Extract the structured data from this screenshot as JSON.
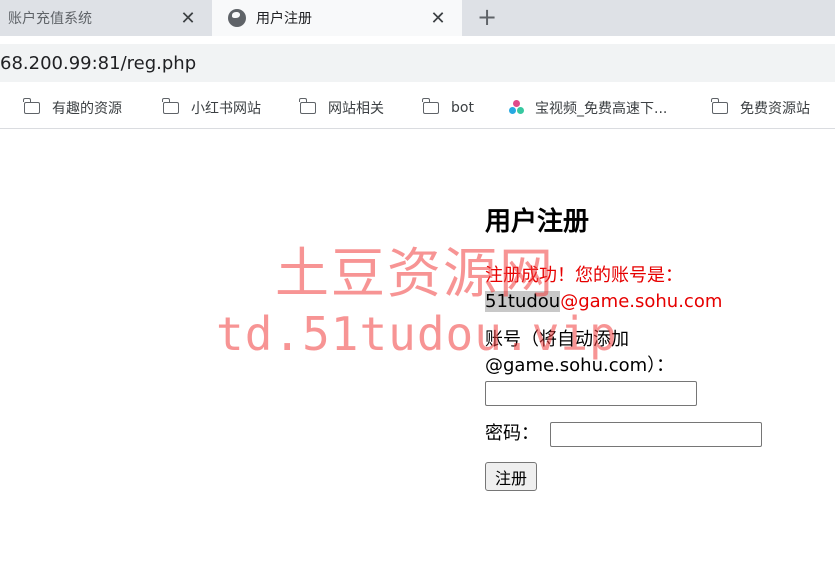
{
  "browser": {
    "tabs": [
      {
        "title": "账户充值系统",
        "active": false
      },
      {
        "title": "用户注册",
        "active": true
      }
    ],
    "close_glyph": "✕",
    "new_tab_glyph": "+",
    "url": "68.200.99:81/reg.php",
    "bookmarks": [
      {
        "label": "有趣的资源",
        "icon": "folder-icon"
      },
      {
        "label": "小红书网站",
        "icon": "folder-icon"
      },
      {
        "label": "网站相关",
        "icon": "folder-icon"
      },
      {
        "label": "bot",
        "icon": "folder-icon"
      },
      {
        "label": "宝视频_免费高速下...",
        "icon": "bilibili-icon"
      },
      {
        "label": "免费资源站",
        "icon": "folder-icon"
      }
    ]
  },
  "page": {
    "title": "用户注册",
    "success_prefix": "注册成功！您的账号是：",
    "success_account": "51tudou",
    "success_domain": "@game.sohu.com",
    "account_label_line1": "账号（将自动添加",
    "account_label_line2": "@game.sohu.com）：",
    "account_value": "",
    "password_label": "密码：",
    "password_value": "",
    "submit_label": "注册"
  },
  "watermark": {
    "line1": "土豆资源网",
    "line2": "td.51tudou.vip"
  },
  "colors": {
    "success_text": "#e60000",
    "watermark": "#f03c3c"
  }
}
